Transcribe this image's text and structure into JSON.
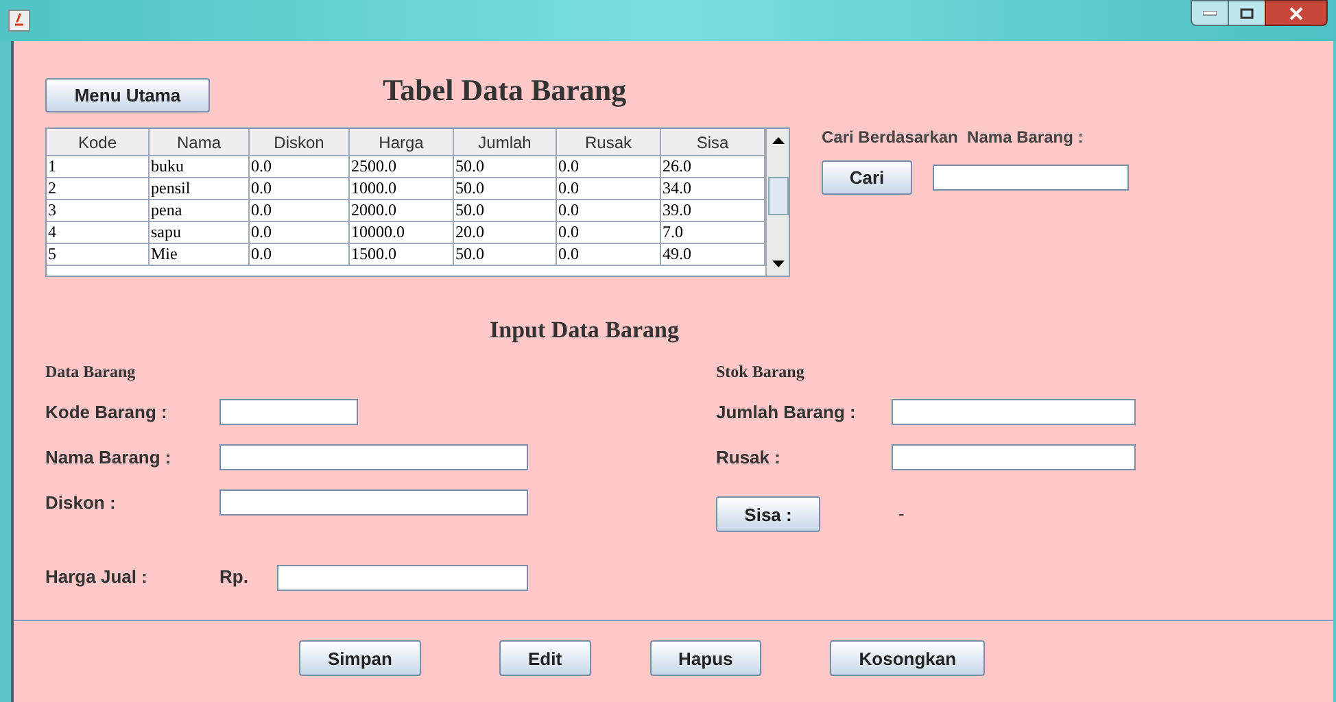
{
  "menu_button": "Menu Utama",
  "title": "Tabel Data Barang",
  "table": {
    "columns": [
      "Kode",
      "Nama",
      "Diskon",
      "Harga",
      "Jumlah",
      "Rusak",
      "Sisa"
    ],
    "rows": [
      [
        "1",
        "buku",
        "0.0",
        "2500.0",
        "50.0",
        "0.0",
        "26.0"
      ],
      [
        "2",
        "pensil",
        "0.0",
        "1000.0",
        "50.0",
        "0.0",
        "34.0"
      ],
      [
        "3",
        "pena",
        "0.0",
        "2000.0",
        "50.0",
        "0.0",
        "39.0"
      ],
      [
        "4",
        "sapu",
        "0.0",
        "10000.0",
        "20.0",
        "0.0",
        "7.0"
      ],
      [
        "5",
        "Mie",
        "0.0",
        "1500.0",
        "50.0",
        "0.0",
        "49.0"
      ]
    ]
  },
  "search": {
    "label": "Cari Berdasarkan  Nama Barang :",
    "button": "Cari"
  },
  "input_title": "Input Data Barang",
  "data_section": {
    "heading": "Data Barang",
    "fields": [
      {
        "label": "Kode Barang :",
        "kind": "short"
      },
      {
        "label": "Nama Barang :",
        "kind": "long"
      },
      {
        "label": "Diskon :",
        "kind": "long"
      },
      {
        "label": "Harga Jual :",
        "kind": "price",
        "prefix": "Rp."
      }
    ]
  },
  "stock_section": {
    "heading": "Stok Barang",
    "fields": [
      {
        "label": "Jumlah Barang :"
      },
      {
        "label": "Rusak :"
      }
    ],
    "sisa_button": "Sisa :",
    "sisa_value": "-"
  },
  "buttons": [
    "Simpan",
    "Edit",
    "Hapus",
    "Kosongkan"
  ]
}
